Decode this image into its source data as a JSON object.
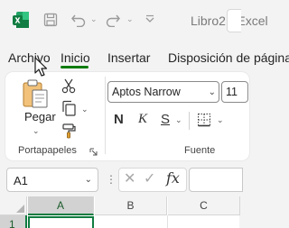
{
  "app": {
    "title": "Libro2 - Excel",
    "brand_color": "#107c41",
    "icon": "excel-logo-icon"
  },
  "quick_access": {
    "save_icon": "save-icon",
    "undo_icon": "undo-icon",
    "redo_icon": "redo-icon"
  },
  "tabs": [
    {
      "label": "Archivo",
      "active": false
    },
    {
      "label": "Inicio",
      "active": true
    },
    {
      "label": "Insertar",
      "active": false
    },
    {
      "label": "Disposición de página",
      "active": false
    }
  ],
  "ribbon": {
    "clipboard": {
      "label": "Portapapeles",
      "paste_label": "Pegar"
    },
    "font": {
      "label": "Fuente",
      "font_name": "Aptos Narrow",
      "font_size": "11",
      "bold_label": "N",
      "italic_label": "K",
      "underline_label": "S"
    }
  },
  "formula_bar": {
    "name_box": "A1",
    "formula": "",
    "fx_label": "fx"
  },
  "grid": {
    "columns": [
      "A",
      "B",
      "C"
    ],
    "rows": [
      "1"
    ],
    "active_cell": "A1"
  }
}
